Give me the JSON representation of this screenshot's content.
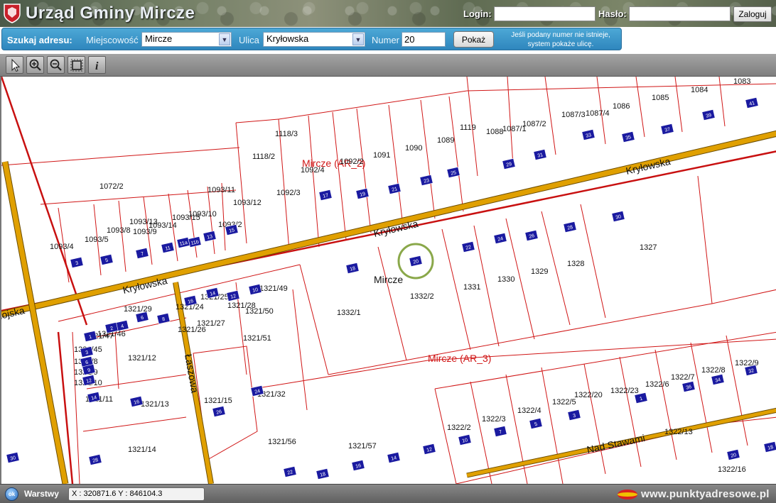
{
  "header": {
    "title": "Urząd Gminy Mircze",
    "login_label": "Login:",
    "password_label": "Hasło:",
    "login_value": "",
    "password_value": "",
    "login_button": "Zaloguj"
  },
  "search": {
    "title": "Szukaj adresu:",
    "town_label": "Miejscowość",
    "town_value": "Mircze",
    "street_label": "Ulica",
    "street_value": "Kryłowska",
    "number_label": "Numer",
    "number_value": "20",
    "show_button": "Pokaż",
    "hint": "Jeśli podany numer nie istnieje, system pokaże ulicę."
  },
  "toolbar": {
    "tools": [
      "select-arrow-icon",
      "zoom-in-icon",
      "zoom-out-icon",
      "full-extent-icon",
      "info-icon"
    ]
  },
  "map": {
    "roads": [
      "Kryłowska",
      "Kryłowska",
      "Kryłowska",
      "Łaszowa",
      "Nad Stawami",
      "nojska"
    ],
    "precincts": [
      "Mircze (AR_2)",
      "Mircze (AR_3)"
    ],
    "place": "Mircze",
    "highlighted_number": "20",
    "parcels": [
      "1083",
      "1084",
      "1085",
      "1086",
      "1087/4",
      "1087/3",
      "1087/2",
      "1087/1",
      "1088",
      "1119",
      "1089",
      "1090",
      "1091",
      "1092/2",
      "1092/4",
      "1118/3",
      "1118/2",
      "1092/3",
      "1072/2",
      "1093/11",
      "1093/12",
      "1093/10",
      "1093/15",
      "1093/14",
      "1093/13",
      "1093/8",
      "1093/9",
      "1093/2",
      "1093/5",
      "1093/4",
      "1327",
      "1328",
      "1329",
      "1330",
      "1331",
      "1332/2",
      "1332/1",
      "1321/49",
      "1321/50",
      "1321/51",
      "1321/24",
      "1321/25",
      "1321/27",
      "1321/26",
      "1321/28",
      "1321/29",
      "1321/46",
      "1321/47",
      "1321/45",
      "1321/8",
      "1321/9",
      "1321/10",
      "1321/11",
      "1321/12",
      "1321/13",
      "1321/14",
      "1321/15",
      "1321/32",
      "1321/56",
      "1321/57",
      "1322/2",
      "1322/3",
      "1322/4",
      "1322/5",
      "1322/20",
      "1322/23",
      "1322/6",
      "1322/7",
      "1322/8",
      "1322/9",
      "1322/16",
      "1322/13"
    ],
    "address_numbers": [
      "41",
      "39",
      "37",
      "35",
      "33",
      "31",
      "29",
      "25",
      "23",
      "21",
      "19",
      "17",
      "15",
      "13",
      "11b",
      "11a",
      "11",
      "7",
      "5",
      "3",
      "30",
      "28",
      "26",
      "24",
      "22",
      "20",
      "18",
      "16",
      "14",
      "12",
      "10",
      "8",
      "6",
      "4",
      "2",
      "1",
      "3",
      "6",
      "9",
      "12",
      "14",
      "16",
      "18",
      "20",
      "22",
      "24",
      "26",
      "28",
      "30",
      "32",
      "34",
      "36",
      "1",
      "3",
      "5",
      "7",
      "10",
      "12",
      "14",
      "16",
      "18",
      "4",
      "6",
      "8",
      "10"
    ]
  },
  "status": {
    "layers_label": "Warstwy",
    "coords": "X : 320871.6  Y : 846104.3",
    "brand": "www.punktyadresowe.pl"
  }
}
